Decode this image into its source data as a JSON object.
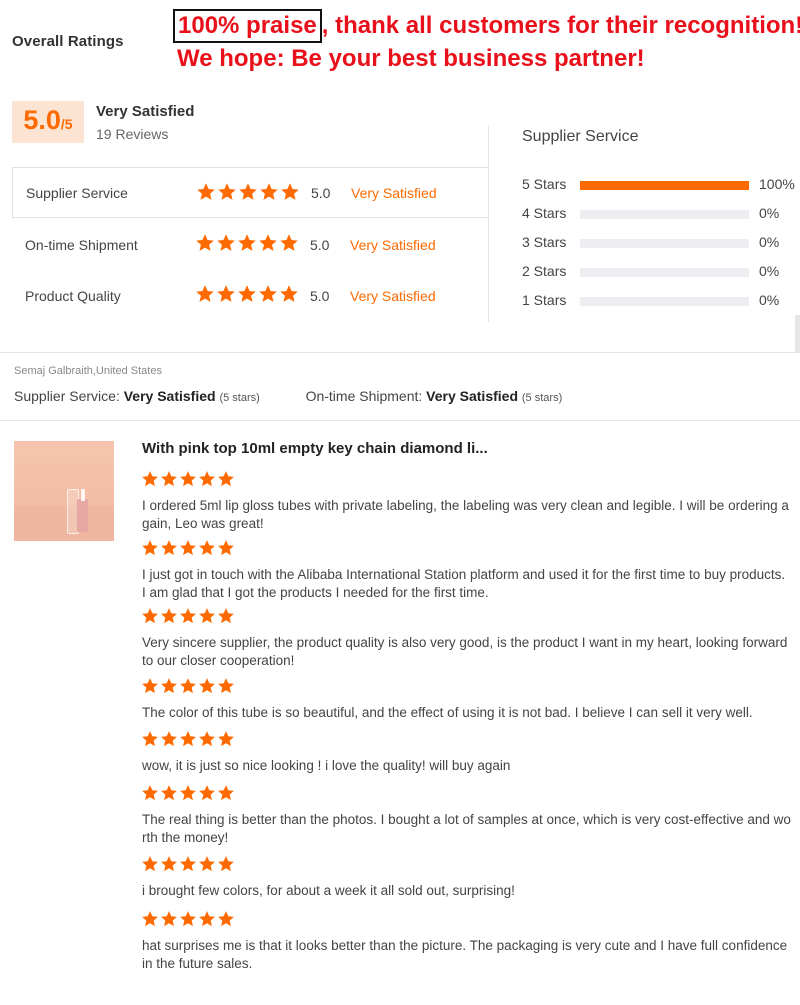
{
  "header": {
    "overall_title": "Overall Ratings",
    "banner_praise": "100% praise",
    "banner_line1_rest": ", thank all customers for their recognition!",
    "banner_line2": "We hope:  Be your best business partner!"
  },
  "summary": {
    "score": "5.0",
    "score_max": "/5",
    "label": "Very Satisfied",
    "reviews": "19 Reviews"
  },
  "categories": [
    {
      "label": "Supplier Service",
      "stars": 5,
      "score": "5.0",
      "text": "Very Satisfied"
    },
    {
      "label": "On-time Shipment",
      "stars": 5,
      "score": "5.0",
      "text": "Very Satisfied"
    },
    {
      "label": "Product Quality",
      "stars": 5,
      "score": "5.0",
      "text": "Very Satisfied"
    }
  ],
  "breakdown": {
    "title": "Supplier Service",
    "rows": [
      {
        "label": "5  Stars",
        "fraction": 1.0,
        "pct": "100%"
      },
      {
        "label": "4  Stars",
        "fraction": 0,
        "pct": "0%"
      },
      {
        "label": "3  Stars",
        "fraction": 0,
        "pct": "0%"
      },
      {
        "label": "2  Stars",
        "fraction": 0,
        "pct": "0%"
      },
      {
        "label": "1  Stars",
        "fraction": 0,
        "pct": "0%"
      }
    ]
  },
  "reviewer": {
    "name": "Semaj Galbraith,United States",
    "service_label": "Supplier Service:",
    "service_value": "Very Satisfied",
    "service_stars": "(5 stars)",
    "shipment_label": "On-time Shipment:",
    "shipment_value": "Very Satisfied",
    "shipment_stars": "(5 stars)"
  },
  "product": {
    "title": "With pink top 10ml empty key chain diamond li..."
  },
  "reviews": [
    {
      "stars": 5,
      "text": "I ordered 5ml lip gloss tubes with private labeling, the labeling was very clean and legible. I will be ordering again, Leo was great!"
    },
    {
      "stars": 5,
      "text": "I just got in touch with the Alibaba International Station platform and used it for the first time to buy products. I am glad that I got the products I needed for the first time."
    },
    {
      "stars": 5,
      "text": "Very sincere supplier, the product quality is also very good, is the product I want in my heart, looking forward to our closer cooperation!"
    },
    {
      "stars": 5,
      "text": "The color of this tube is so beautiful, and the effect of using it is not bad. I believe I can sell it very well."
    },
    {
      "stars": 5,
      "text": "wow, it is just so nice looking ! i love the quality! will buy again"
    },
    {
      "stars": 5,
      "text": "The real thing is better than the photos. I bought a lot of samples at once, which is very cost-effective and worth the money!"
    },
    {
      "stars": 5,
      "text": "i brought few colors, for about a week it all sold out, surprising!"
    },
    {
      "stars": 5,
      "text": "hat surprises me is that it looks better than the picture. The packaging is very cute and I have full confidence in the future sales."
    }
  ],
  "colors": {
    "accent": "#ff6a00",
    "banner_red": "#e8101a",
    "score_bg": "#fce3d2"
  },
  "icons": {
    "star": "star-icon"
  }
}
